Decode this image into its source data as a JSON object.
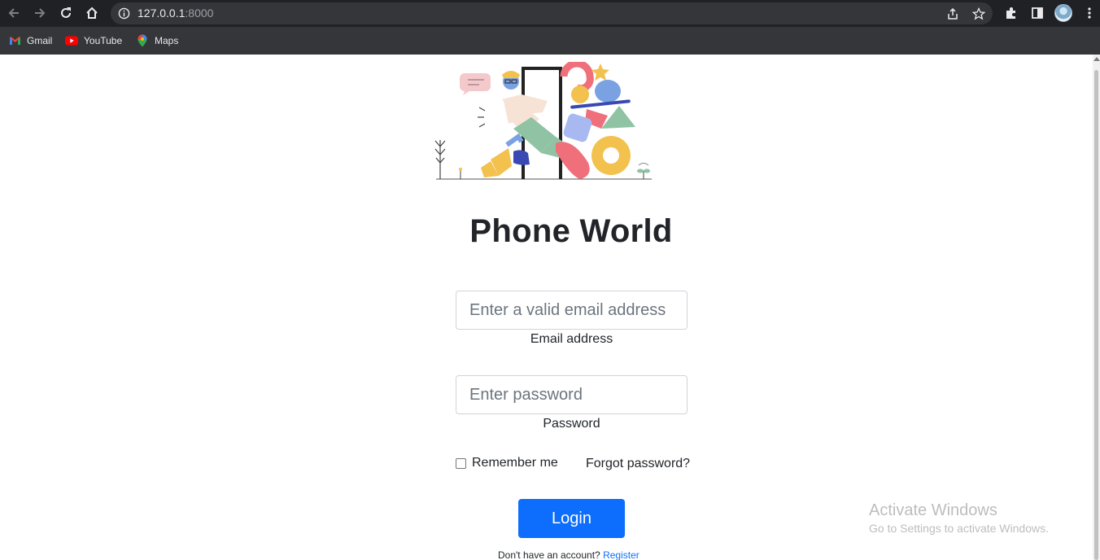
{
  "browser": {
    "url_host": "127.0.0.1",
    "url_port": ":8000",
    "bookmarks": [
      {
        "label": "Gmail",
        "icon": "gmail-icon"
      },
      {
        "label": "YouTube",
        "icon": "youtube-icon"
      },
      {
        "label": "Maps",
        "icon": "maps-icon"
      }
    ]
  },
  "page": {
    "title": "Phone World",
    "email": {
      "placeholder": "Enter a valid email address",
      "label": "Email address"
    },
    "password": {
      "placeholder": "Enter password",
      "label": "Password"
    },
    "remember_label": "Remember me",
    "forgot_label": "Forgot password?",
    "login_label": "Login",
    "register_prompt": "Don't have an account?",
    "register_link": "Register"
  },
  "watermark": {
    "line1": "Activate Windows",
    "line2": "Go to Settings to activate Windows."
  },
  "colors": {
    "primary": "#0d6efd",
    "chrome_dark": "#202124",
    "chrome_bar": "#35363a"
  }
}
